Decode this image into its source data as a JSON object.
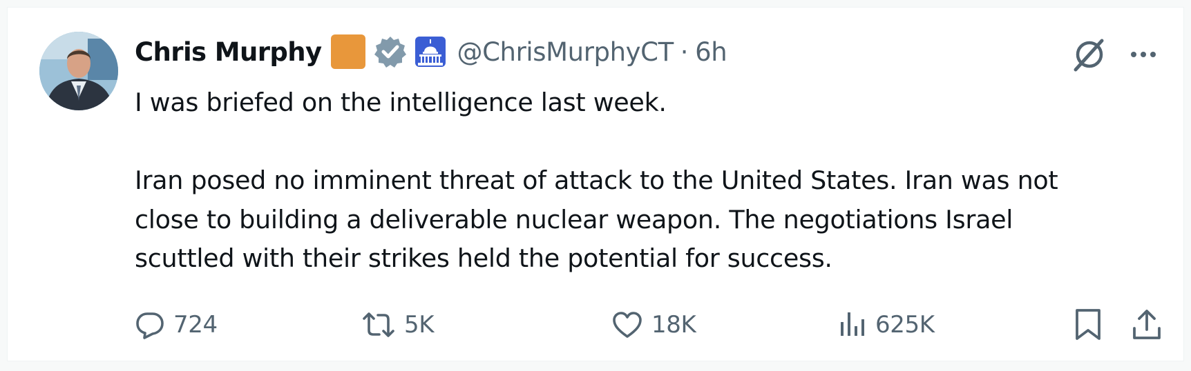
{
  "author": {
    "display_name": "Chris Murphy",
    "handle": "@ChrisMurphyCT",
    "separator": "·",
    "time": "6h",
    "badges": [
      "orange-square-badge",
      "verified-badge",
      "capitol-building-badge"
    ],
    "avatar": "avatar-photo"
  },
  "tweet": {
    "paragraph_1": "I was briefed on the intelligence last week.",
    "paragraph_2_line_1": "Iran posed no imminent threat of attack to the United States. Iran was not",
    "paragraph_2_line_2": "close to building a deliverable nuclear weapon. The negotiations Israel",
    "paragraph_2_line_3": "scuttled with their strikes held the potential for success."
  },
  "actions": {
    "replies": "724",
    "reposts": "5K",
    "likes": "18K",
    "views": "625K"
  },
  "icons": {
    "top_right": [
      "grok-icon",
      "more-icon"
    ],
    "bar": [
      "reply-icon",
      "repost-icon",
      "like-icon",
      "views-icon",
      "bookmark-icon",
      "share-icon"
    ]
  },
  "colors": {
    "text_primary": "#0f1419",
    "text_secondary": "#536471",
    "badge_orange": "#e8973b",
    "verified_gray": "#829aab",
    "capitol_blue": "#3b5ed4"
  }
}
